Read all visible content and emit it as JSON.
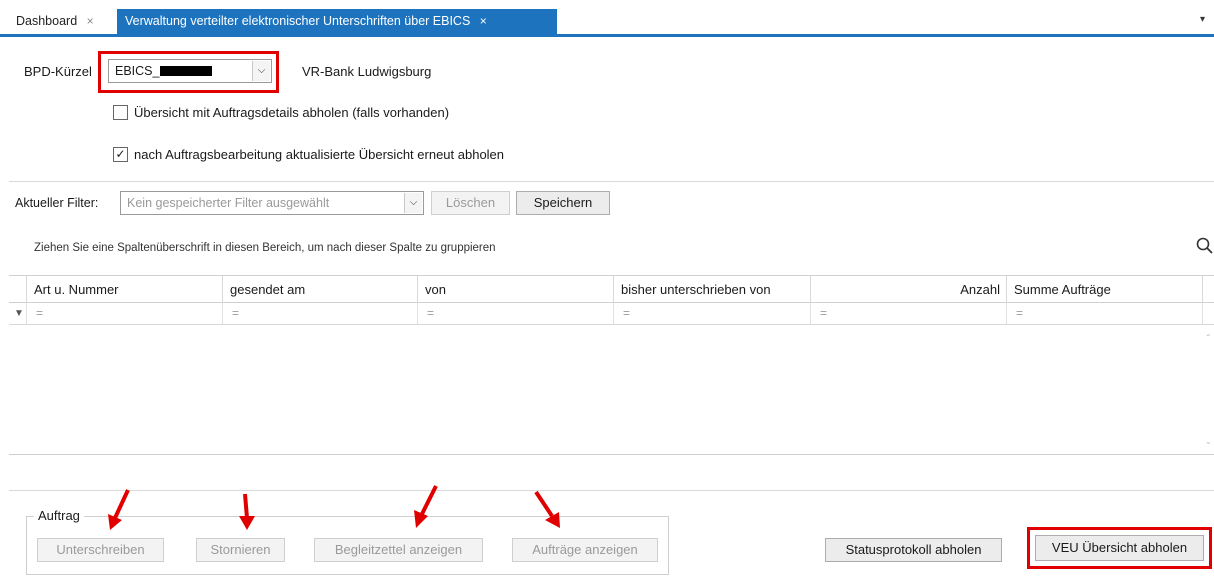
{
  "tabs": [
    {
      "label": "Dashboard",
      "close": "×"
    },
    {
      "label": "Verwaltung verteilter elektronischer Unterschriften über EBICS",
      "close": "×"
    }
  ],
  "tab_menu_glyph": "▾",
  "bpd": {
    "label": "BPD-Kürzel",
    "value": "EBICS_",
    "bank_name": "VR-Bank Ludwigsburg"
  },
  "options": {
    "details_label": "Übersicht mit Auftragsdetails abholen (falls vorhanden)",
    "details_checked": false,
    "refresh_label": "nach Auftragsbearbeitung aktualisierte Übersicht erneut abholen",
    "refresh_checked": true
  },
  "filter": {
    "label": "Aktueller Filter:",
    "placeholder": "Kein gespeicherter Filter ausgewählt",
    "delete_label": "Löschen",
    "save_label": "Speichern"
  },
  "grid": {
    "group_hint": "Ziehen Sie eine Spaltenüberschrift in diesen Bereich, um nach dieser Spalte zu gruppieren",
    "columns": [
      "Art u. Nummer",
      "gesendet am",
      "von",
      "bisher unterschrieben von",
      "Anzahl",
      "Summe Aufträge"
    ],
    "filter_symbol": "="
  },
  "auftrag": {
    "title": "Auftrag",
    "sign_label": "Unterschreiben",
    "cancel_label": "Stornieren",
    "slip_label": "Begleitzettel anzeigen",
    "show_label": "Aufträge anzeigen"
  },
  "actions": {
    "status_label": "Statusprotokoll abholen",
    "veu_label": "VEU Übersicht abholen"
  },
  "colors": {
    "accent": "#1e73be",
    "highlight": "#e00000"
  }
}
